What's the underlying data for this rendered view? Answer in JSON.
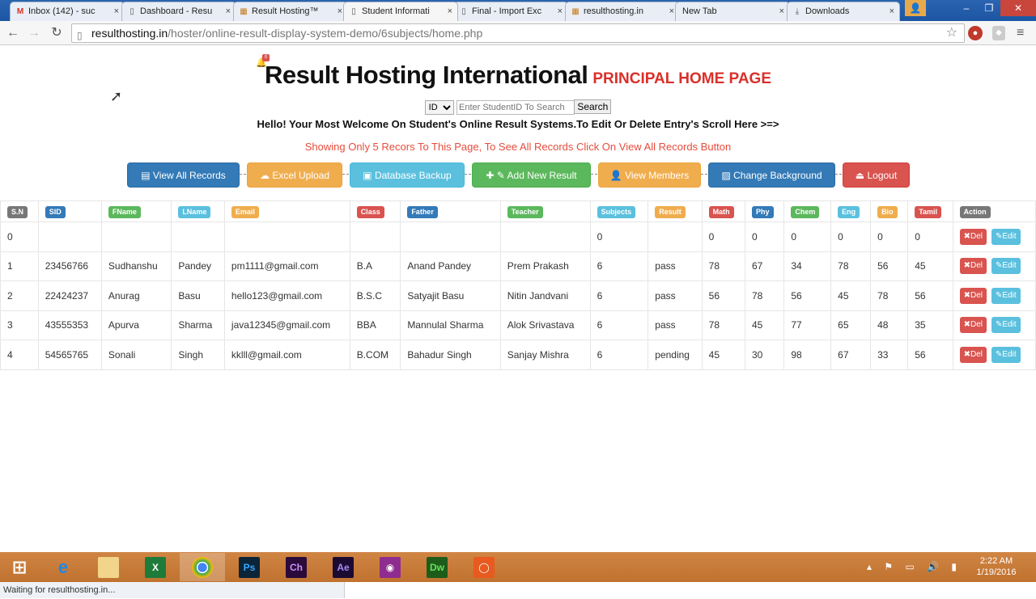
{
  "browser": {
    "tabs": [
      {
        "label": "Inbox (142) - suc",
        "icon": "gmail-icon"
      },
      {
        "label": "Dashboard - Resu",
        "icon": "page-icon"
      },
      {
        "label": "Result Hosting™",
        "icon": "site-icon"
      },
      {
        "label": "Student Informati",
        "icon": "page-icon"
      },
      {
        "label": "Final - Import Exc",
        "icon": "page-icon"
      },
      {
        "label": "resulthosting.in",
        "icon": "site-icon"
      },
      {
        "label": "New Tab",
        "icon": ""
      },
      {
        "label": "Downloads",
        "icon": "download-icon"
      }
    ],
    "url_host": "resulthosting.in",
    "url_path": "/hoster/online-result-display-system-demo/6subjects/home.php",
    "status_text": "Waiting for resulthosting.in..."
  },
  "page": {
    "title": "Result Hosting International",
    "subtitle": "PRINCIPAL HOME PAGE",
    "notification_count": "0",
    "search": {
      "select_value": "ID",
      "placeholder": "Enter StudentID To Search",
      "button": "Search"
    },
    "welcome": "Hello! Your Most Welcome On Student's Online Result Systems.To Edit Or Delete Entry's Scroll Here >=>",
    "showing": "Showing Only 5 Recors To This Page, To See All Records Click On View All Records Button",
    "buttons": [
      {
        "label": "View All Records",
        "icon": "▤",
        "style": "primary"
      },
      {
        "label": "Excel Upload",
        "icon": "☁",
        "style": "warning"
      },
      {
        "label": "Database Backup",
        "icon": "▣",
        "style": "info"
      },
      {
        "label": "Add New Result",
        "icon": "✚ ✎",
        "style": "success"
      },
      {
        "label": "View Members",
        "icon": "👤",
        "style": "warning"
      },
      {
        "label": "Change Background",
        "icon": "▨",
        "style": "primary"
      },
      {
        "label": "Logout",
        "icon": "⏏",
        "style": "danger"
      }
    ]
  },
  "table": {
    "headers": [
      {
        "label": "S.N",
        "color": "default"
      },
      {
        "label": "SID",
        "color": "primary"
      },
      {
        "label": "FName",
        "color": "success"
      },
      {
        "label": "LName",
        "color": "info"
      },
      {
        "label": "Email",
        "color": "warning"
      },
      {
        "label": "Class",
        "color": "danger"
      },
      {
        "label": "Father",
        "color": "primary"
      },
      {
        "label": "Teacher",
        "color": "success"
      },
      {
        "label": "Subjects",
        "color": "info"
      },
      {
        "label": "Result",
        "color": "warning"
      },
      {
        "label": "Math",
        "color": "danger"
      },
      {
        "label": "Phy",
        "color": "primary"
      },
      {
        "label": "Chem",
        "color": "success"
      },
      {
        "label": "Eng",
        "color": "info"
      },
      {
        "label": "Bio",
        "color": "warning"
      },
      {
        "label": "Tamil",
        "color": "danger"
      },
      {
        "label": "Action",
        "color": "default"
      }
    ],
    "rows": [
      [
        "0",
        "",
        "",
        "",
        "",
        "",
        "",
        "",
        "0",
        "",
        "0",
        "0",
        "0",
        "0",
        "0",
        "0"
      ],
      [
        "1",
        "23456766",
        "Sudhanshu",
        "Pandey",
        "pm1111@gmail.com",
        "B.A",
        "Anand Pandey",
        "Prem Prakash",
        "6",
        "pass",
        "78",
        "67",
        "34",
        "78",
        "56",
        "45"
      ],
      [
        "2",
        "22424237",
        "Anurag",
        "Basu",
        "hello123@gmail.com",
        "B.S.C",
        "Satyajit Basu",
        "Nitin Jandvani",
        "6",
        "pass",
        "56",
        "78",
        "56",
        "45",
        "78",
        "56"
      ],
      [
        "3",
        "43555353",
        "Apurva",
        "Sharma",
        "java12345@gmail.com",
        "BBA",
        "Mannulal Sharma",
        "Alok Srivastava",
        "6",
        "pass",
        "78",
        "45",
        "77",
        "65",
        "48",
        "35"
      ],
      [
        "4",
        "54565765",
        "Sonali",
        "Singh",
        "kklll@gmail.com",
        "B.COM",
        "Bahadur Singh",
        "Sanjay Mishra",
        "6",
        "pending",
        "45",
        "30",
        "98",
        "67",
        "33",
        "56"
      ]
    ],
    "del_label": "Del",
    "edit_label": "Edit"
  },
  "taskbar": {
    "apps": [
      "IE",
      "Explorer",
      "Excel",
      "Chrome",
      "Ps",
      "Ch",
      "Ae",
      "Camera",
      "Dw",
      "Office"
    ],
    "time": "2:22 AM",
    "date": "1/19/2016"
  }
}
